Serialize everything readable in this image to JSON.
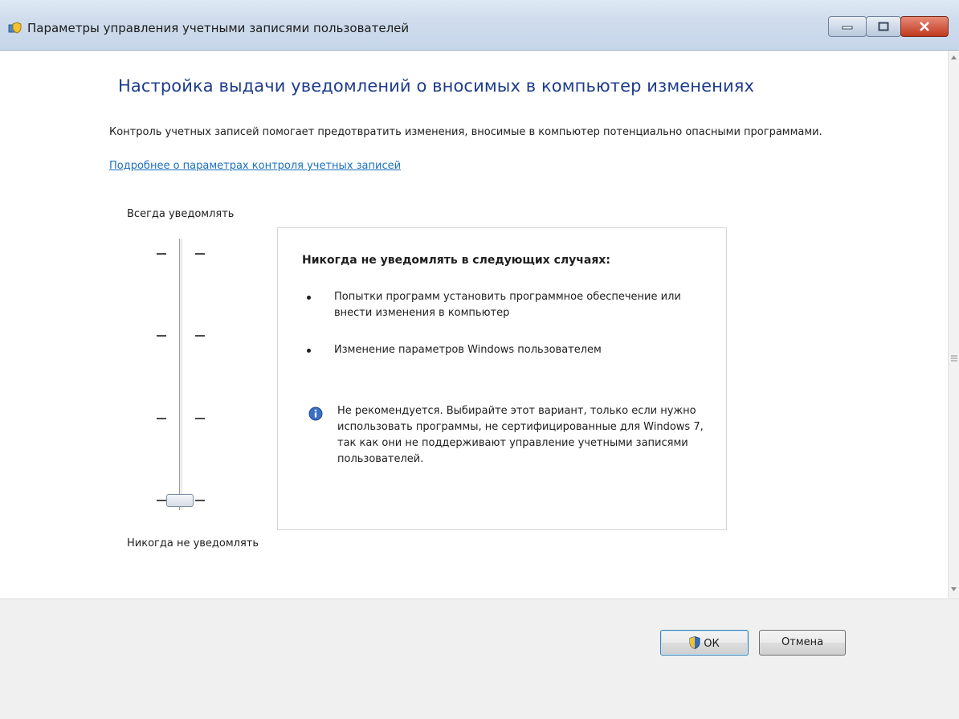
{
  "window": {
    "title": "Параметры управления учетными записями пользователей",
    "icon": "uac-settings-icon",
    "controls": [
      "minimize",
      "maximize",
      "close"
    ]
  },
  "content": {
    "heading": "Настройка выдачи уведомлений о вносимых в компьютер изменениях",
    "description": "Контроль учетных записей помогает предотвратить изменения, вносимые в компьютер потенциально опасными программами.",
    "learn_more_link": "Подробнее о параметрах контроля учетных записей"
  },
  "slider": {
    "top_label": "Всегда уведомлять",
    "bottom_label": "Никогда не уведомлять",
    "levels": 4,
    "selected_level": 1,
    "selected_label": "Никогда не уведомлять"
  },
  "panel": {
    "title": "Никогда не уведомлять в следующих случаях:",
    "bullets": [
      "Попытки программ установить программное обеспечение или внести изменения в компьютер",
      "Изменение параметров Windows пользователем"
    ],
    "warning_icon": "info-icon",
    "warning": "Не рекомендуется. Выбирайте этот вариант, только если нужно использовать программы, не сертифицированные для Windows 7, так как они не поддерживают управление учетными записями пользователей."
  },
  "footer": {
    "ok_label": "ОК",
    "ok_icon": "uac-shield-icon",
    "cancel_label": "Отмена"
  },
  "colors": {
    "heading": "#1e3c8c",
    "link": "#1a6fbf",
    "close_button": "#c0381f"
  }
}
